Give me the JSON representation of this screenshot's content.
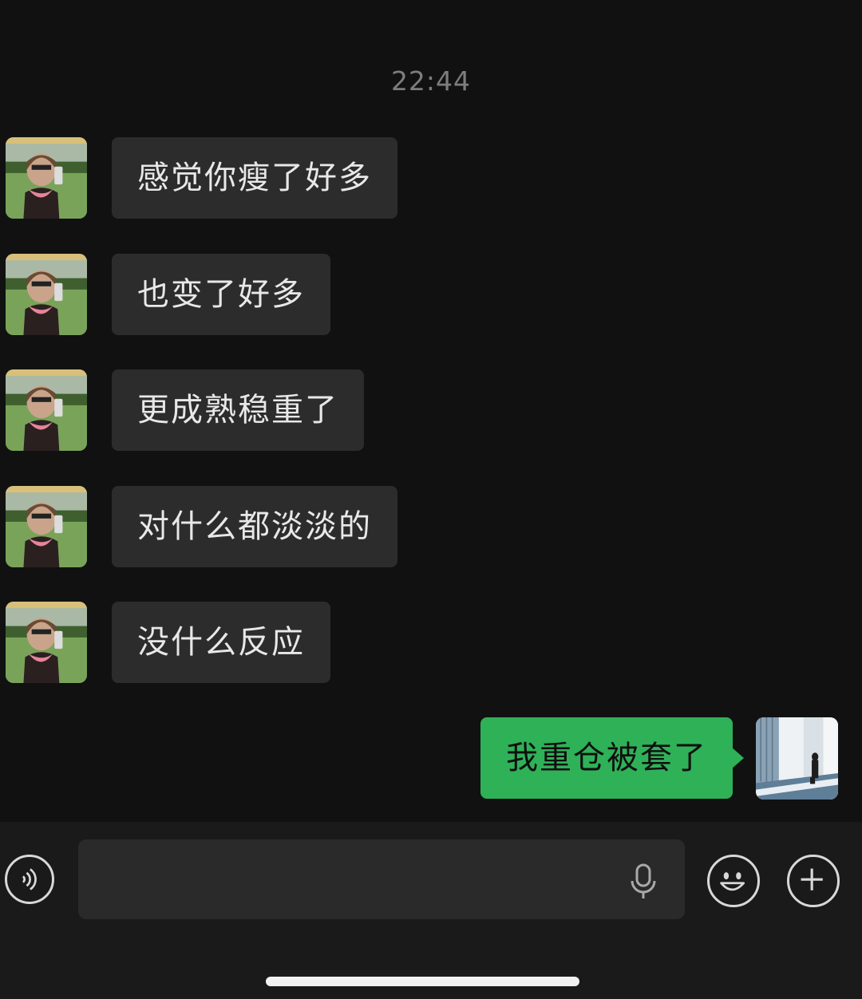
{
  "chat": {
    "timestamp": "22:44",
    "messages": [
      {
        "sender": "contact",
        "text": "感觉你瘦了好多"
      },
      {
        "sender": "contact",
        "text": "也变了好多"
      },
      {
        "sender": "contact",
        "text": "更成熟稳重了"
      },
      {
        "sender": "contact",
        "text": "对什么都淡淡的"
      },
      {
        "sender": "contact",
        "text": "没什么反应"
      },
      {
        "sender": "self",
        "text": "我重仓被套了"
      }
    ]
  },
  "toolbar": {
    "voice_icon": "voice-icon",
    "mic_icon": "microphone-icon",
    "emoji_icon": "emoji-icon",
    "plus_icon": "plus-icon"
  },
  "colors": {
    "background": "#111111",
    "contact_bubble": "#2c2c2c",
    "self_bubble": "#2fb157",
    "toolbar": "#1a1a1a"
  }
}
